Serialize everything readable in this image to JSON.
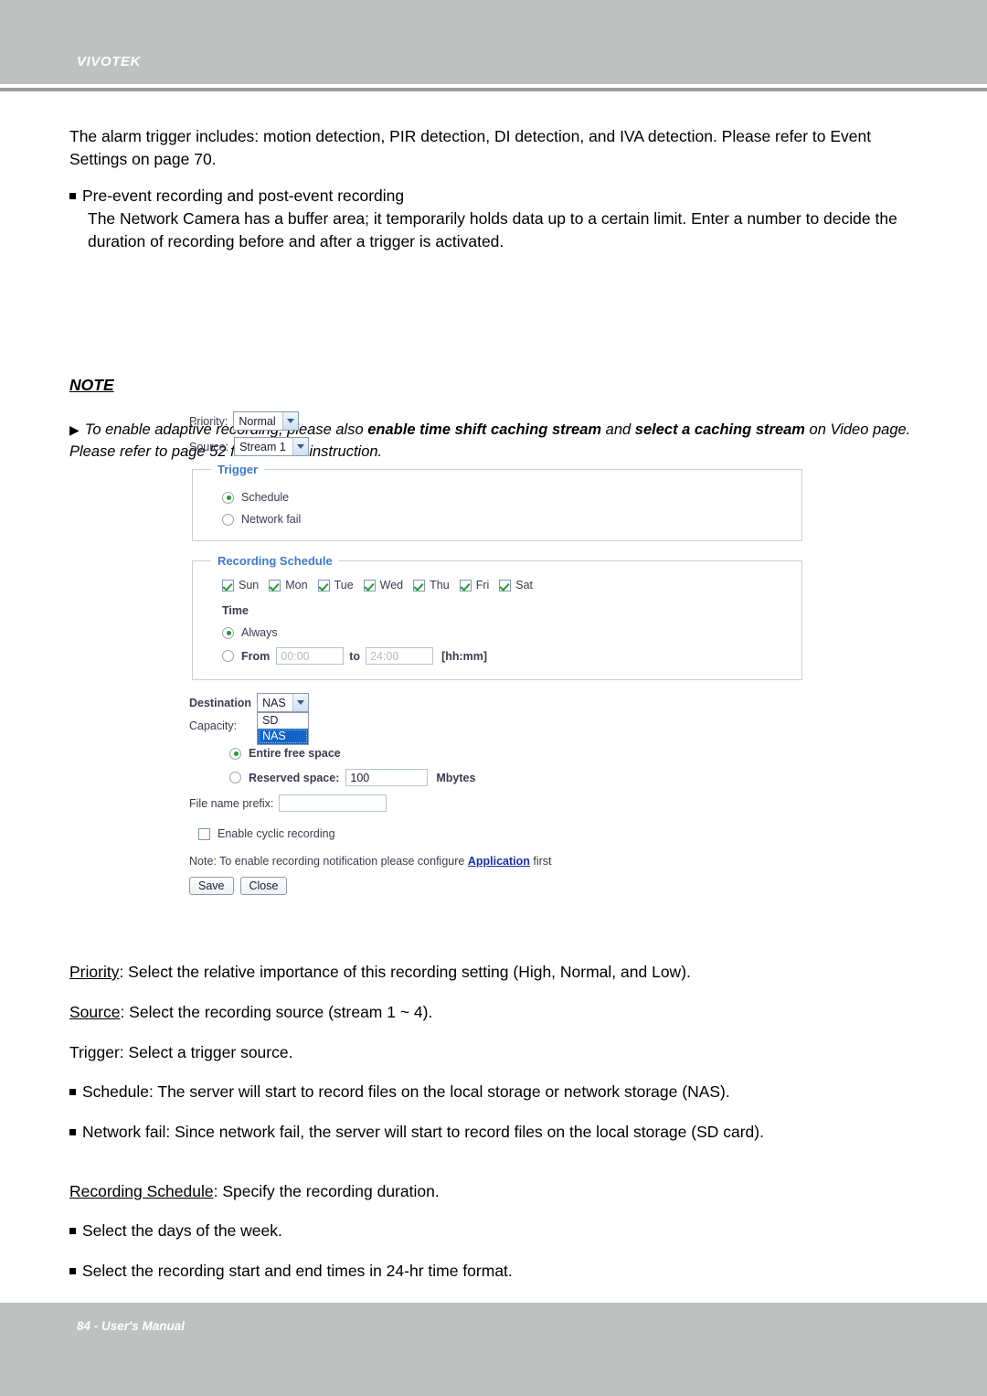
{
  "header": {
    "brand": "VIVOTEK"
  },
  "footer": {
    "text": "84 - User's Manual"
  },
  "body": {
    "intro": "The alarm trigger includes: motion detection, PIR detection, DI detection, and IVA detection. Please refer to Event Settings on page 70.",
    "preevent_title": "Pre-event recording and post-event recording",
    "preevent_body": "The Network Camera has a buffer area; it temporarily holds data up to a certain limit. Enter a number to decide the duration of recording before and after a trigger is activated."
  },
  "note": {
    "title": "NOTE",
    "arrow": "▶",
    "part1": "To enable adaptive recording, please also ",
    "bold1": "enable time shift caching stream",
    "part2": " and ",
    "bold2": "select a caching stream",
    "part3": " on Video page. Please refer to page 52 for detailed instruction."
  },
  "form": {
    "priority": {
      "label": "Priority:",
      "value": "Normal"
    },
    "source": {
      "label": "Source:",
      "value": "Stream 1"
    },
    "trigger": {
      "legend": "Trigger",
      "options": [
        {
          "label": "Schedule",
          "selected": true
        },
        {
          "label": "Network fail",
          "selected": false
        }
      ]
    },
    "recording_schedule": {
      "legend": "Recording Schedule",
      "days": [
        {
          "label": "Sun",
          "checked": true
        },
        {
          "label": "Mon",
          "checked": true
        },
        {
          "label": "Tue",
          "checked": true
        },
        {
          "label": "Wed",
          "checked": true
        },
        {
          "label": "Thu",
          "checked": true
        },
        {
          "label": "Fri",
          "checked": true
        },
        {
          "label": "Sat",
          "checked": true
        }
      ],
      "time_label": "Time",
      "always_label": "Always",
      "always_selected": true,
      "from_label": "From",
      "from_placeholder": "00:00",
      "from_value": "",
      "to_label": "to",
      "to_placeholder": "24:00",
      "to_value": "",
      "format_hint": "[hh:mm]"
    },
    "destination": {
      "label": "Destination",
      "value": "NAS",
      "open": true,
      "options": [
        "SD",
        "NAS"
      ],
      "selected_option": "NAS"
    },
    "capacity": {
      "label": "Capacity:",
      "entire_label": "Entire free space",
      "entire_selected": true,
      "reserved_label": "Reserved space:",
      "reserved_value": "100",
      "reserved_unit": "Mbytes"
    },
    "file_prefix": {
      "label": "File name prefix:",
      "value": ""
    },
    "cyclic": {
      "label": "Enable cyclic recording",
      "checked": false
    },
    "note_prefix": "Note: To enable recording notification please configure ",
    "note_link": "Application",
    "note_suffix": " first",
    "save_label": "Save",
    "close_label": "Close"
  },
  "descriptions": {
    "priority_term": "Priority",
    "priority_text": ": Select the relative importance of this recording setting (High, Normal, and Low).",
    "source_term": "Source",
    "source_text": ": Select the recording source (stream 1 ~ 4).",
    "trigger_line": "Trigger: Select a trigger source.",
    "schedule_bullet": "Schedule: The server will start to record files on the local storage or network storage (NAS).",
    "networkfail_bullet": "Network fail: Since network fail, the server will start to record files on the local storage (SD card).",
    "recsched_term": "Recording Schedule",
    "recsched_text": ": Specify the recording duration.",
    "days_bullet": "Select the days of the week.",
    "times_bullet": "Select the recording start and end times in 24-hr time format."
  }
}
